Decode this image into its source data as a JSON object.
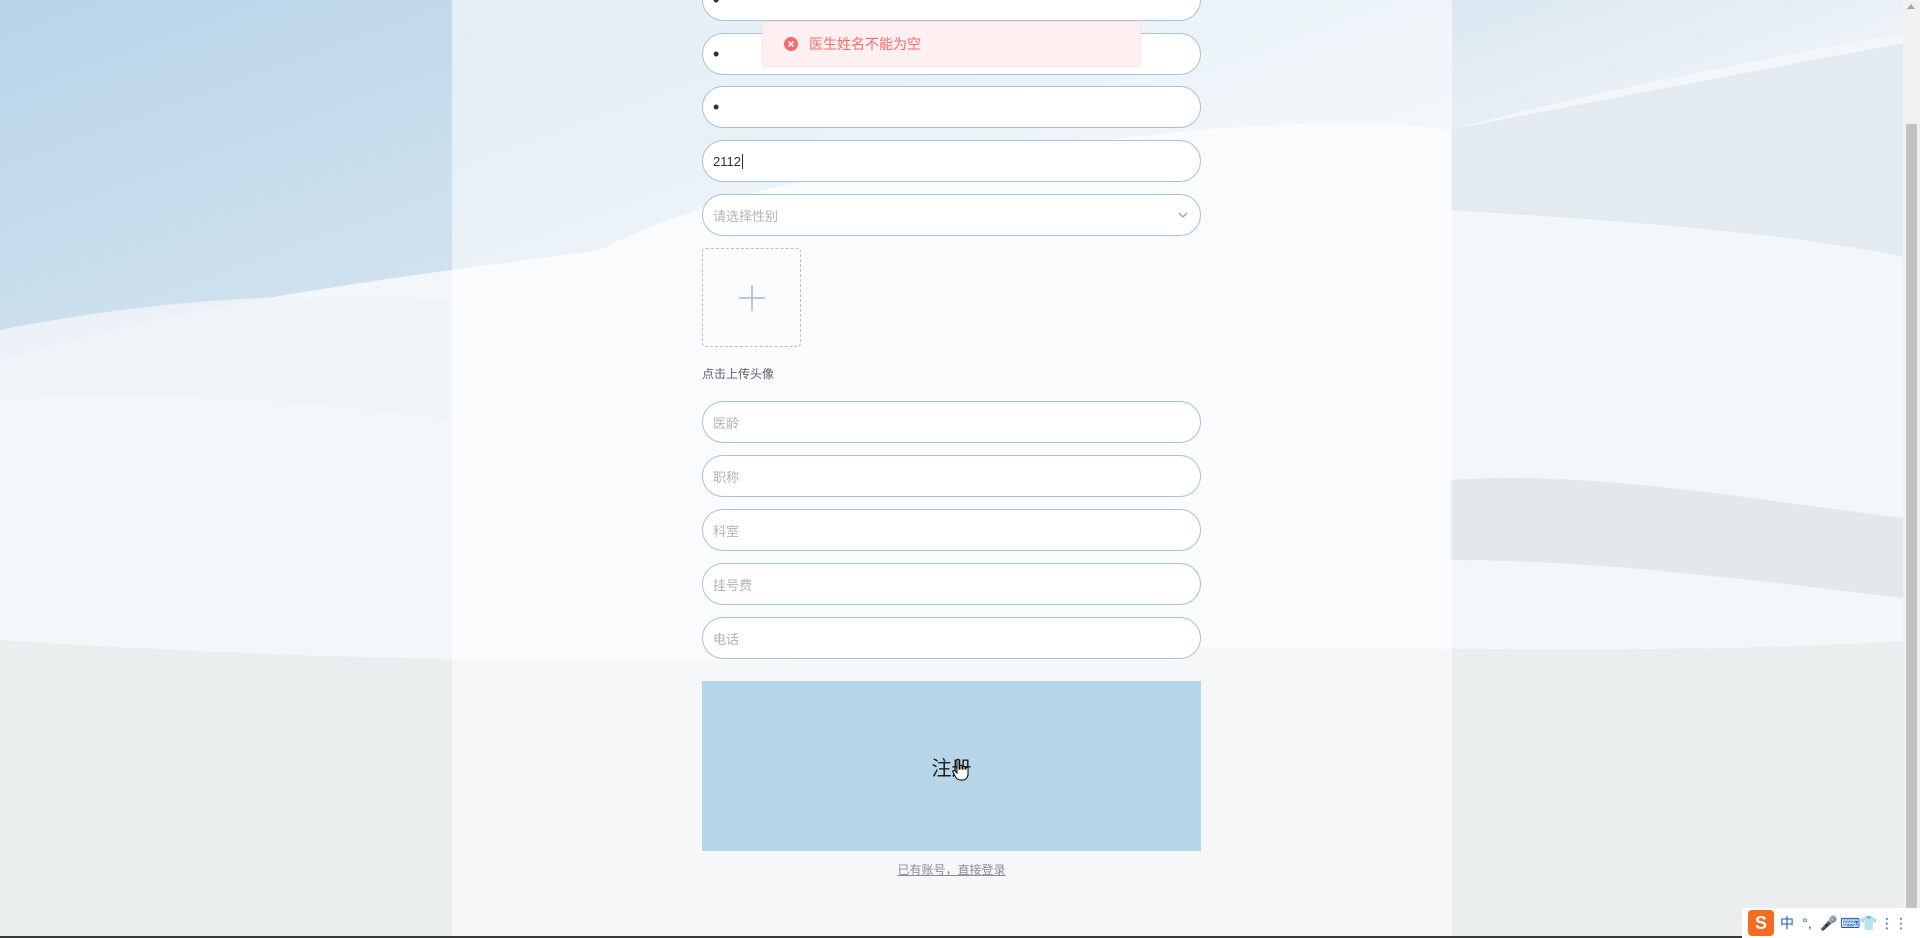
{
  "toast": {
    "message": "医生姓名不能为空"
  },
  "form": {
    "field1_value": "•",
    "field2_value": "•",
    "field3_value": "•",
    "field4_value": "2112",
    "gender_placeholder": "请选择性别",
    "upload_label": "点击上传头像",
    "seniority_placeholder": "医龄",
    "title_placeholder": "职称",
    "department_placeholder": "科室",
    "fee_placeholder": "挂号费",
    "phone_placeholder": "电话",
    "submit_label": "注册",
    "login_link": "已有账号，直接登录"
  },
  "ime": {
    "logo": "S",
    "lang": "中",
    "punct": "°,",
    "mic": "🎤",
    "keyboard": "⌨",
    "skin": "👕",
    "menu": "⋮⋮"
  },
  "colors": {
    "toast_text": "#f56c6c",
    "toast_bg": "#fef0f0",
    "submit_bg": "#b8d6e9",
    "field_border": "#a7c3d9"
  }
}
